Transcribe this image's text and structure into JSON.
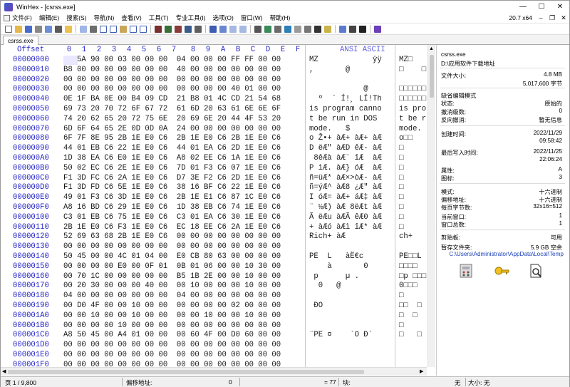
{
  "title": "WinHex - [csrss.exe]",
  "window_buttons": {
    "minimize": "—",
    "maximize": "☐",
    "close": "✕"
  },
  "menu": [
    "文件(F)",
    "编辑(E)",
    "搜索(S)",
    "导航(N)",
    "查看(V)",
    "工具(T)",
    "专业工具(I)",
    "选项(O)",
    "窗口(W)",
    "帮助(H)"
  ],
  "version": "20.7 x64",
  "tab": "csrss.exe",
  "hex_header": {
    "offset": "Offset",
    "cols": [
      "0",
      "1",
      "2",
      "3",
      "4",
      "5",
      "6",
      "7",
      "8",
      "9",
      "A",
      "B",
      "C",
      "D",
      "E",
      "F"
    ],
    "ansi": "ANSI ASCII"
  },
  "rows": [
    {
      "off": "00000000",
      "hex": "4D 5A 90 00 03 00 00 00  04 00 00 00 FF FF 00 00",
      "ansi": "MZ            ÿÿ",
      "a2": "MZ□"
    },
    {
      "off": "00000010",
      "hex": "B8 00 00 00 00 00 00 00  40 00 00 00 00 00 00 00",
      "ansi": ",       @       ",
      "a2": "□    □"
    },
    {
      "off": "00000020",
      "hex": "00 00 00 00 00 00 00 00  00 00 00 00 00 00 00 00",
      "ansi": "                ",
      "a2": ""
    },
    {
      "off": "00000030",
      "hex": "00 00 00 00 00 00 00 00  00 00 00 00 40 01 00 00",
      "ansi": "            @   ",
      "a2": "□□□□□□"
    },
    {
      "off": "00000040",
      "hex": "0E 1F BA 0E 00 B4 09 CD  21 B8 01 4C CD 21 54 68",
      "ansi": "  º  ´ Í!¸ LÍ!Th",
      "a2": "□□□□□□"
    },
    {
      "off": "00000050",
      "hex": "69 73 20 70 72 6F 67 72  61 6D 20 63 61 6E 6E 6F",
      "ansi": "is program canno",
      "a2": "is pro"
    },
    {
      "off": "00000060",
      "hex": "74 20 62 65 20 72 75 6E  20 69 6E 20 44 4F 53 20",
      "ansi": "t be run in DOS ",
      "a2": "t be r"
    },
    {
      "off": "00000070",
      "hex": "6D 6F 64 65 2E 0D 0D 0A  24 00 00 00 00 00 00 00",
      "ansi": "mode.   $       ",
      "a2": "mode."
    },
    {
      "off": "00000080",
      "hex": "6F 7F 8E 95 2B 1E E0 C6  2B 1E E0 C6 2B 1E E0 C6",
      "ansi": "o Ž•+ àÆ+ àÆ+ àÆ",
      "a2": "o□□"
    },
    {
      "off": "00000090",
      "hex": "44 01 EB C6 22 1E E0 C6  44 01 EA C6 2D 1E E0 C6",
      "ansi": "D ëÆ\" àÆD êÆ- àÆ",
      "a2": "□"
    },
    {
      "off": "000000A0",
      "hex": "1D 38 EA C6 E0 1E E0 C6  A8 02 EE C6 1A 1E E0 C6",
      "ansi": " 8êÆà àÆ¨ îÆ  àÆ",
      "a2": "□"
    },
    {
      "off": "000000B0",
      "hex": "50 02 EC C6 2E 1E E0 C6  7D 01 F3 C6 07 1E E0 C6",
      "ansi": "P ìÆ. àÆ} óÆ  àÆ",
      "a2": "□"
    },
    {
      "off": "000000C0",
      "hex": "F1 3D FC C6 2A 1E E0 C6  D7 3E F2 C6 2D 1E E0 C6",
      "ansi": "ñ=üÆ* àÆ×>òÆ- àÆ",
      "a2": "□"
    },
    {
      "off": "000000D0",
      "hex": "F1 3D FD C6 5E 1E E0 C6  38 16 BF C6 22 1E E0 C6",
      "ansi": "ñ=ýÆ^ àÆ8 ¿Æ\" àÆ",
      "a2": "□"
    },
    {
      "off": "000000E0",
      "hex": "49 01 F3 C6 3D 1E E0 C6  2B 1E E1 C6 87 1C E0 C6",
      "ansi": "I óÆ= àÆ+ áÆ‡ àÆ",
      "a2": "□"
    },
    {
      "off": "000000F0",
      "hex": "A8 16 BD C6 29 1E E0 C6  1D 38 EB C6 74 1E E0 C6",
      "ansi": "¨ ½Æ) àÆ 8ëÆt àÆ",
      "a2": "□"
    },
    {
      "off": "00000100",
      "hex": "C3 01 EB C6 75 1E E0 C6  C3 01 EA C6 30 1E E0 C6",
      "ansi": "Ã ëÆu àÆÃ êÆ0 àÆ",
      "a2": "□"
    },
    {
      "off": "00000110",
      "hex": "2B 1E E0 C6 F3 1E E0 C6  EC 18 EE C6 2A 1E E0 C6",
      "ansi": "+ àÆó àÆì îÆ* àÆ",
      "a2": "□"
    },
    {
      "off": "00000120",
      "hex": "52 69 63 68 2B 1E E0 C6  00 00 00 00 00 00 00 00",
      "ansi": "Rich+ àÆ        ",
      "a2": "ch+"
    },
    {
      "off": "00000130",
      "hex": "00 00 00 00 00 00 00 00  00 00 00 00 00 00 00 00",
      "ansi": "                ",
      "a2": ""
    },
    {
      "off": "00000140",
      "hex": "50 45 00 00 4C 01 04 00  E0 CB 80 63 00 00 00 00",
      "ansi": "PE  L   àË€c    ",
      "a2": "PE□□L"
    },
    {
      "off": "00000150",
      "hex": "00 00 00 00 E0 00 0F 01  0B 01 06 00 00 10 30 00",
      "ansi": "    à       0   ",
      "a2": "□□□□"
    },
    {
      "off": "00000160",
      "hex": "00 70 1C 00 00 00 00 00  B5 1B 2E 00 00 10 00 00",
      "ansi": " p      µ .     ",
      "a2": "□p □□□"
    },
    {
      "off": "00000170",
      "hex": "00 20 30 00 00 00 40 00  00 10 00 00 00 10 00 00",
      "ansi": "  0   @         ",
      "a2": "0□□□"
    },
    {
      "off": "00000180",
      "hex": "04 00 00 00 00 00 00 00  04 00 00 00 00 00 00 00",
      "ansi": "                ",
      "a2": "□"
    },
    {
      "off": "00000190",
      "hex": "00 D0 4F 00 00 10 00 00  00 00 00 00 02 00 00 00",
      "ansi": " ÐO             ",
      "a2": "□□  □"
    },
    {
      "off": "000001A0",
      "hex": "00 00 10 00 00 10 00 00  00 00 10 00 00 10 00 00",
      "ansi": "                ",
      "a2": "□  □"
    },
    {
      "off": "000001B0",
      "hex": "00 00 00 00 10 00 00 00  00 00 00 00 00 00 00 00",
      "ansi": "                ",
      "a2": "□"
    },
    {
      "off": "000001C0",
      "hex": "A8 50 45 00 A4 01 00 00  00 60 4F 00 D0 60 00 00",
      "ansi": "¨PE ¤    `O Ð`  ",
      "a2": "□   □"
    },
    {
      "off": "000001D0",
      "hex": "00 00 00 00 00 00 00 00  00 00 00 00 00 00 00 00",
      "ansi": "                ",
      "a2": ""
    },
    {
      "off": "000001E0",
      "hex": "00 00 00 00 00 00 00 00  00 00 00 00 00 00 00 00",
      "ansi": "                ",
      "a2": ""
    },
    {
      "off": "000001F0",
      "hex": "00 00 00 00 00 00 00 00  00 00 00 00 00 00 00 00",
      "ansi": "                ",
      "a2": ""
    }
  ],
  "info": {
    "filename": "csrss.exe",
    "path": "D:\\应用软件下载地址",
    "size_label": "文件大小:",
    "size_mb": "4.8 MB",
    "size_bytes": "5,017,600 字节",
    "edit_mode_label": "缺省编辑模式",
    "state_label": "状态:",
    "state_value": "原始的",
    "undo_level_label": "撤消级数:",
    "undo_level_value": "0",
    "reverse_undo_label": "反向撤消:",
    "reverse_undo_value": "暂无信息",
    "created_label": "创建时间:",
    "created_date": "2022/11/29",
    "created_time": "09:58:42",
    "modified_label": "最后写入时间:",
    "modified_date": "2022/11/25",
    "modified_time": "22:06:24",
    "attr_label": "属性:",
    "attr_value": "A",
    "icon_label": "图标:",
    "icon_value": "3",
    "mode_label": "模式:",
    "mode_value": "十六进制",
    "offset_label": "偏移地址:",
    "offset_value": "十六进制",
    "bytes_per_page_label": "每页字节数:",
    "bytes_per_page_value": "32x16=512",
    "cur_window_label": "当前窗口:",
    "cur_window_value": "1",
    "total_windows_label": "窗口总数:",
    "total_windows_value": "1",
    "clipboard_label": "剪贴板:",
    "clipboard_value": "可用",
    "temp_folder_label": "暂存文件夹:",
    "temp_folder_space": "5.9 GB 空余",
    "temp_folder_path": "C:\\Users\\Administrator\\AppData\\Local\\Temp"
  },
  "status": {
    "page": "页 1 / 9,800",
    "offset_label": "偏移地址:",
    "offset_value": "0",
    "value": "= 77",
    "block_label": "块:",
    "none_1": "无",
    "size_label": "大小:",
    "none_2": "无"
  },
  "colors": {
    "offset_blue": "#2727c8",
    "accent": "#1b3fb5"
  }
}
